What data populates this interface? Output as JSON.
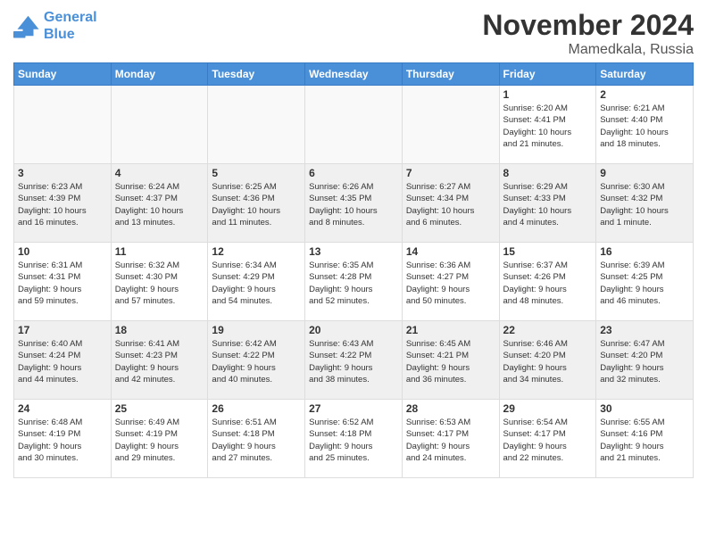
{
  "logo": {
    "line1": "General",
    "line2": "Blue"
  },
  "title": "November 2024",
  "location": "Mamedkala, Russia",
  "headers": [
    "Sunday",
    "Monday",
    "Tuesday",
    "Wednesday",
    "Thursday",
    "Friday",
    "Saturday"
  ],
  "weeks": [
    [
      {
        "day": "",
        "info": ""
      },
      {
        "day": "",
        "info": ""
      },
      {
        "day": "",
        "info": ""
      },
      {
        "day": "",
        "info": ""
      },
      {
        "day": "",
        "info": ""
      },
      {
        "day": "1",
        "info": "Sunrise: 6:20 AM\nSunset: 4:41 PM\nDaylight: 10 hours\nand 21 minutes."
      },
      {
        "day": "2",
        "info": "Sunrise: 6:21 AM\nSunset: 4:40 PM\nDaylight: 10 hours\nand 18 minutes."
      }
    ],
    [
      {
        "day": "3",
        "info": "Sunrise: 6:23 AM\nSunset: 4:39 PM\nDaylight: 10 hours\nand 16 minutes."
      },
      {
        "day": "4",
        "info": "Sunrise: 6:24 AM\nSunset: 4:37 PM\nDaylight: 10 hours\nand 13 minutes."
      },
      {
        "day": "5",
        "info": "Sunrise: 6:25 AM\nSunset: 4:36 PM\nDaylight: 10 hours\nand 11 minutes."
      },
      {
        "day": "6",
        "info": "Sunrise: 6:26 AM\nSunset: 4:35 PM\nDaylight: 10 hours\nand 8 minutes."
      },
      {
        "day": "7",
        "info": "Sunrise: 6:27 AM\nSunset: 4:34 PM\nDaylight: 10 hours\nand 6 minutes."
      },
      {
        "day": "8",
        "info": "Sunrise: 6:29 AM\nSunset: 4:33 PM\nDaylight: 10 hours\nand 4 minutes."
      },
      {
        "day": "9",
        "info": "Sunrise: 6:30 AM\nSunset: 4:32 PM\nDaylight: 10 hours\nand 1 minute."
      }
    ],
    [
      {
        "day": "10",
        "info": "Sunrise: 6:31 AM\nSunset: 4:31 PM\nDaylight: 9 hours\nand 59 minutes."
      },
      {
        "day": "11",
        "info": "Sunrise: 6:32 AM\nSunset: 4:30 PM\nDaylight: 9 hours\nand 57 minutes."
      },
      {
        "day": "12",
        "info": "Sunrise: 6:34 AM\nSunset: 4:29 PM\nDaylight: 9 hours\nand 54 minutes."
      },
      {
        "day": "13",
        "info": "Sunrise: 6:35 AM\nSunset: 4:28 PM\nDaylight: 9 hours\nand 52 minutes."
      },
      {
        "day": "14",
        "info": "Sunrise: 6:36 AM\nSunset: 4:27 PM\nDaylight: 9 hours\nand 50 minutes."
      },
      {
        "day": "15",
        "info": "Sunrise: 6:37 AM\nSunset: 4:26 PM\nDaylight: 9 hours\nand 48 minutes."
      },
      {
        "day": "16",
        "info": "Sunrise: 6:39 AM\nSunset: 4:25 PM\nDaylight: 9 hours\nand 46 minutes."
      }
    ],
    [
      {
        "day": "17",
        "info": "Sunrise: 6:40 AM\nSunset: 4:24 PM\nDaylight: 9 hours\nand 44 minutes."
      },
      {
        "day": "18",
        "info": "Sunrise: 6:41 AM\nSunset: 4:23 PM\nDaylight: 9 hours\nand 42 minutes."
      },
      {
        "day": "19",
        "info": "Sunrise: 6:42 AM\nSunset: 4:22 PM\nDaylight: 9 hours\nand 40 minutes."
      },
      {
        "day": "20",
        "info": "Sunrise: 6:43 AM\nSunset: 4:22 PM\nDaylight: 9 hours\nand 38 minutes."
      },
      {
        "day": "21",
        "info": "Sunrise: 6:45 AM\nSunset: 4:21 PM\nDaylight: 9 hours\nand 36 minutes."
      },
      {
        "day": "22",
        "info": "Sunrise: 6:46 AM\nSunset: 4:20 PM\nDaylight: 9 hours\nand 34 minutes."
      },
      {
        "day": "23",
        "info": "Sunrise: 6:47 AM\nSunset: 4:20 PM\nDaylight: 9 hours\nand 32 minutes."
      }
    ],
    [
      {
        "day": "24",
        "info": "Sunrise: 6:48 AM\nSunset: 4:19 PM\nDaylight: 9 hours\nand 30 minutes."
      },
      {
        "day": "25",
        "info": "Sunrise: 6:49 AM\nSunset: 4:19 PM\nDaylight: 9 hours\nand 29 minutes."
      },
      {
        "day": "26",
        "info": "Sunrise: 6:51 AM\nSunset: 4:18 PM\nDaylight: 9 hours\nand 27 minutes."
      },
      {
        "day": "27",
        "info": "Sunrise: 6:52 AM\nSunset: 4:18 PM\nDaylight: 9 hours\nand 25 minutes."
      },
      {
        "day": "28",
        "info": "Sunrise: 6:53 AM\nSunset: 4:17 PM\nDaylight: 9 hours\nand 24 minutes."
      },
      {
        "day": "29",
        "info": "Sunrise: 6:54 AM\nSunset: 4:17 PM\nDaylight: 9 hours\nand 22 minutes."
      },
      {
        "day": "30",
        "info": "Sunrise: 6:55 AM\nSunset: 4:16 PM\nDaylight: 9 hours\nand 21 minutes."
      }
    ]
  ]
}
